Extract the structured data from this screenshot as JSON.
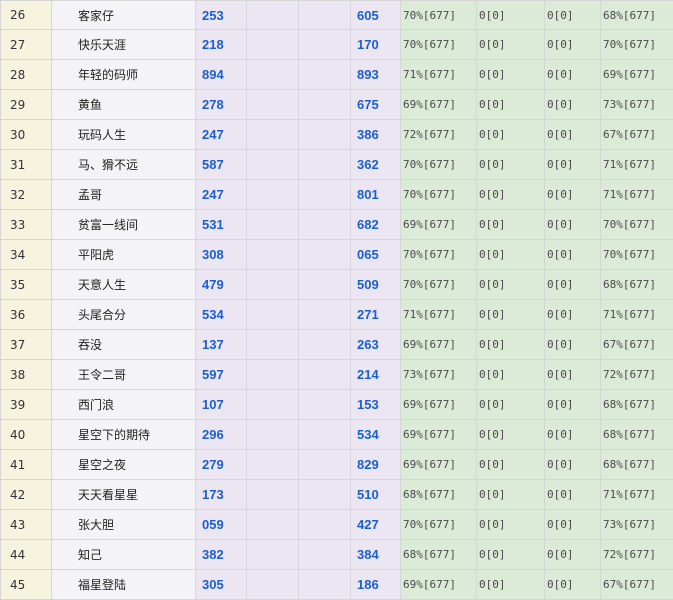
{
  "table": {
    "rows": [
      {
        "idx": "26",
        "name": "客家仔",
        "v1": "253",
        "v2": "605",
        "p1": "70%[677]",
        "z1": "0[0]",
        "z2": "0[0]",
        "p2": "68%[677]"
      },
      {
        "idx": "27",
        "name": "快乐天涯",
        "v1": "218",
        "v2": "170",
        "p1": "70%[677]",
        "z1": "0[0]",
        "z2": "0[0]",
        "p2": "70%[677]"
      },
      {
        "idx": "28",
        "name": "年轻的码师",
        "v1": "894",
        "v2": "893",
        "p1": "71%[677]",
        "z1": "0[0]",
        "z2": "0[0]",
        "p2": "69%[677]"
      },
      {
        "idx": "29",
        "name": "黄鱼",
        "v1": "278",
        "v2": "675",
        "p1": "69%[677]",
        "z1": "0[0]",
        "z2": "0[0]",
        "p2": "73%[677]"
      },
      {
        "idx": "30",
        "name": "玩码人生",
        "v1": "247",
        "v2": "386",
        "p1": "72%[677]",
        "z1": "0[0]",
        "z2": "0[0]",
        "p2": "67%[677]"
      },
      {
        "idx": "31",
        "name": "马、猾不远",
        "v1": "587",
        "v2": "362",
        "p1": "70%[677]",
        "z1": "0[0]",
        "z2": "0[0]",
        "p2": "71%[677]"
      },
      {
        "idx": "32",
        "name": "孟哥",
        "v1": "247",
        "v2": "801",
        "p1": "70%[677]",
        "z1": "0[0]",
        "z2": "0[0]",
        "p2": "71%[677]"
      },
      {
        "idx": "33",
        "name": "贫富一线间",
        "v1": "531",
        "v2": "682",
        "p1": "69%[677]",
        "z1": "0[0]",
        "z2": "0[0]",
        "p2": "70%[677]"
      },
      {
        "idx": "34",
        "name": "平阳虎",
        "v1": "308",
        "v2": "065",
        "p1": "70%[677]",
        "z1": "0[0]",
        "z2": "0[0]",
        "p2": "70%[677]"
      },
      {
        "idx": "35",
        "name": "天意人生",
        "v1": "479",
        "v2": "509",
        "p1": "70%[677]",
        "z1": "0[0]",
        "z2": "0[0]",
        "p2": "68%[677]"
      },
      {
        "idx": "36",
        "name": "头尾合分",
        "v1": "534",
        "v2": "271",
        "p1": "71%[677]",
        "z1": "0[0]",
        "z2": "0[0]",
        "p2": "71%[677]"
      },
      {
        "idx": "37",
        "name": "吞没",
        "v1": "137",
        "v2": "263",
        "p1": "69%[677]",
        "z1": "0[0]",
        "z2": "0[0]",
        "p2": "67%[677]"
      },
      {
        "idx": "38",
        "name": "王令二哥",
        "v1": "597",
        "v2": "214",
        "p1": "73%[677]",
        "z1": "0[0]",
        "z2": "0[0]",
        "p2": "72%[677]"
      },
      {
        "idx": "39",
        "name": "西门浪",
        "v1": "107",
        "v2": "153",
        "p1": "69%[677]",
        "z1": "0[0]",
        "z2": "0[0]",
        "p2": "68%[677]"
      },
      {
        "idx": "40",
        "name": "星空下的期待",
        "v1": "296",
        "v2": "534",
        "p1": "69%[677]",
        "z1": "0[0]",
        "z2": "0[0]",
        "p2": "68%[677]"
      },
      {
        "idx": "41",
        "name": "星空之夜",
        "v1": "279",
        "v2": "829",
        "p1": "69%[677]",
        "z1": "0[0]",
        "z2": "0[0]",
        "p2": "68%[677]"
      },
      {
        "idx": "42",
        "name": "天天看星星",
        "v1": "173",
        "v2": "510",
        "p1": "68%[677]",
        "z1": "0[0]",
        "z2": "0[0]",
        "p2": "71%[677]"
      },
      {
        "idx": "43",
        "name": "张大胆",
        "v1": "059",
        "v2": "427",
        "p1": "70%[677]",
        "z1": "0[0]",
        "z2": "0[0]",
        "p2": "73%[677]"
      },
      {
        "idx": "44",
        "name": "知己",
        "v1": "382",
        "v2": "384",
        "p1": "68%[677]",
        "z1": "0[0]",
        "z2": "0[0]",
        "p2": "72%[677]"
      },
      {
        "idx": "45",
        "name": "福星登陆",
        "v1": "305",
        "v2": "186",
        "p1": "69%[677]",
        "z1": "0[0]",
        "z2": "0[0]",
        "p2": "67%[677]"
      }
    ]
  }
}
